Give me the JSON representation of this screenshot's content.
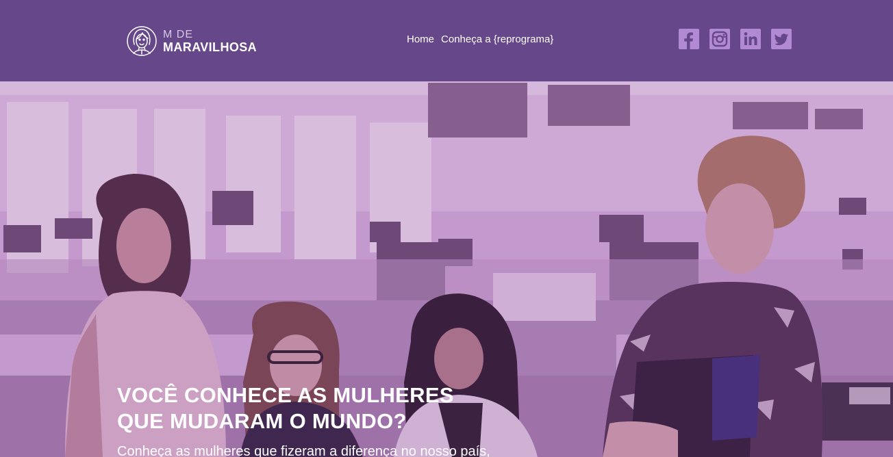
{
  "brand": {
    "line1": "M DE",
    "line2": "MARAVILHOSA",
    "icon": "woman-face-logo-icon"
  },
  "nav": {
    "items": [
      {
        "label": "Home"
      },
      {
        "label": "Conheça a {reprograma}"
      }
    ]
  },
  "socials": [
    {
      "icon": "facebook-icon"
    },
    {
      "icon": "instagram-icon"
    },
    {
      "icon": "linkedin-icon"
    },
    {
      "icon": "twitter-icon"
    }
  ],
  "hero": {
    "title_line1": "VOCÊ CONHECE AS MULHERES",
    "title_line2": "QUE MUDARAM O MUNDO?",
    "subtitle": "Conheça as mulheres que fizeram a diferença no nosso país,",
    "image": "office-women-photo"
  },
  "colors": {
    "header_bg": "#66478a",
    "social_icon": "#b28ad3",
    "hero_tint": "#c9a0d4",
    "text": "#ffffff"
  }
}
